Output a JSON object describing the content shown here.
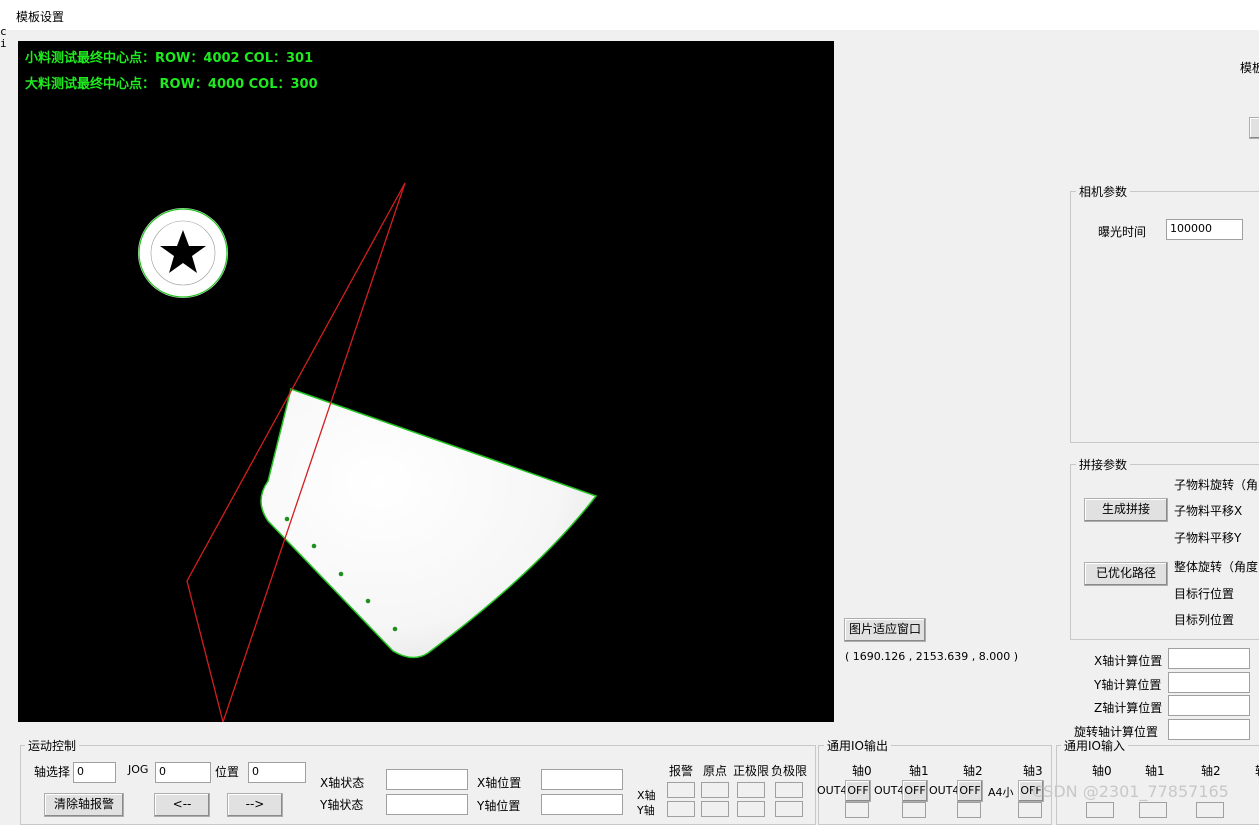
{
  "window": {
    "title": "模板设置",
    "left_text": [
      "c",
      "i"
    ]
  },
  "viewer": {
    "overlay_line1": "小料测试最终中心点：ROW：4002 COL：301",
    "overlay_line2": "大料测试最终中心点：  ROW：4000 COL：300",
    "logo_text": "DJOF DNGS NKL'S ACDS DNCMK AIOV",
    "outline_color": "#22c322",
    "roi_color": "#d21e1e"
  },
  "fit_button": "图片适应窗口",
  "coord_readout": "( 1690.126 , 2153.639 , 8.000 )",
  "top_right_partial": "模板",
  "camera": {
    "title": "相机参数",
    "exposure_label": "曝光时间",
    "exposure_value": "100000"
  },
  "stitch": {
    "title": "拼接参数",
    "generate_button": "生成拼接",
    "optimized_button": "已优化路径",
    "labels": [
      "子物料旋转（角",
      "子物料平移X",
      "子物料平移Y",
      "整体旋转（角度",
      "目标行位置",
      "目标列位置"
    ]
  },
  "calc": {
    "x_label": "X轴计算位置",
    "y_label": "Y轴计算位置",
    "z_label": "Z轴计算位置",
    "rot_label": "旋转轴计算位置"
  },
  "motion": {
    "title": "运动控制",
    "axis_select_label": "轴选择",
    "axis_select_value": "0",
    "jog_label": "JOG",
    "jog_value": "0",
    "position_label": "位置",
    "position_value": "0",
    "clear_alarm_button": "清除轴报警",
    "left_button": "<--",
    "right_button": "-->",
    "x_status_label": "X轴状态",
    "y_status_label": "Y轴状态",
    "x_pos_label": "X轴位置",
    "y_pos_label": "Y轴位置",
    "status_headers": [
      "报警",
      "原点",
      "正极限",
      "负极限"
    ],
    "row_labels": [
      "X轴",
      "Y轴"
    ]
  },
  "io_out": {
    "title": "通用IO输出",
    "axes": [
      "轴0",
      "轴1",
      "轴2",
      "轴3"
    ],
    "items": [
      {
        "name": "OUT4",
        "state": "OFF"
      },
      {
        "name": "OUT4",
        "state": "OFF"
      },
      {
        "name": "OUT4",
        "state": "OFF"
      },
      {
        "name": "A4小",
        "state": "OFF"
      }
    ]
  },
  "io_in": {
    "title": "通用IO输入",
    "axes": [
      "轴0",
      "轴1",
      "轴2",
      "轴"
    ]
  },
  "watermark": "CSDN @2301_77857165"
}
